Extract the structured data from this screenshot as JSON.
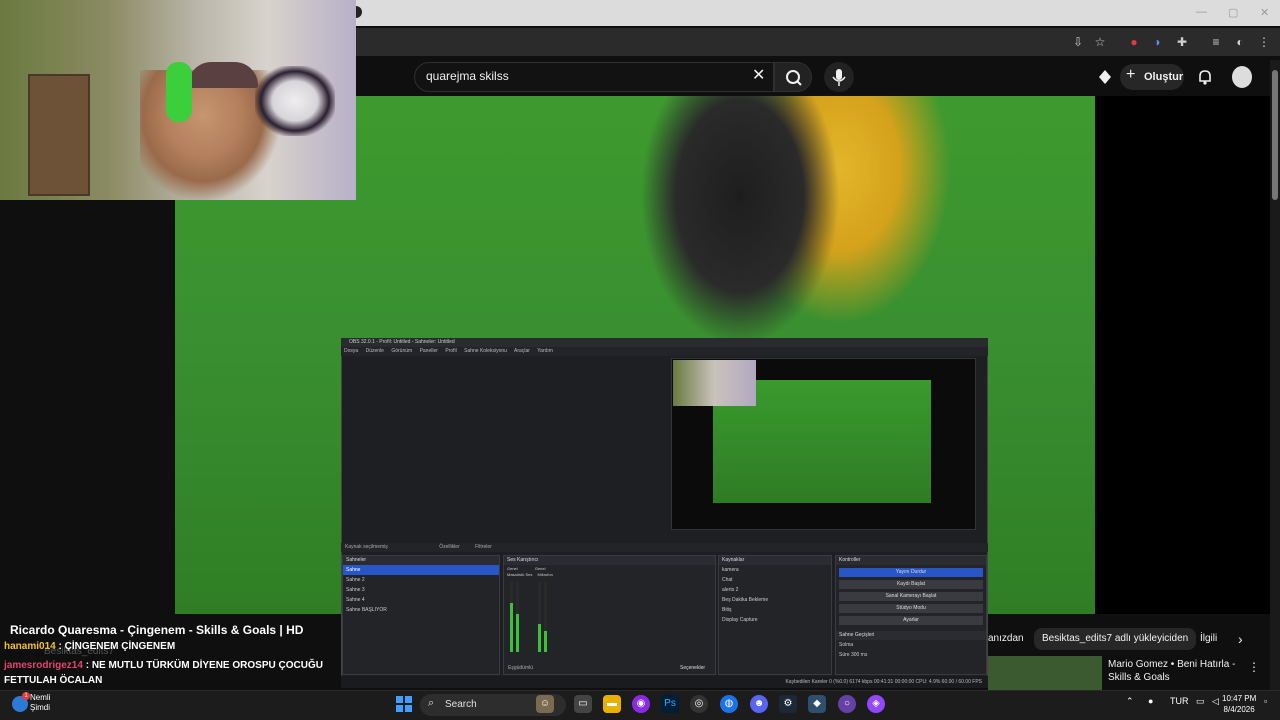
{
  "browser": {
    "window_controls": [
      "—",
      "▢",
      "✕"
    ],
    "icons": [
      "download-icon",
      "star-icon",
      "extension-shield-icon",
      "translate-icon",
      "puzzle-icon",
      "media-icon",
      "profile-icon",
      "more-icon"
    ]
  },
  "youtube": {
    "search": {
      "value": "quarejma skilss"
    },
    "create_label": "Oluştur",
    "video_title": "Ricardo Quaresma - Çingenem - Skills & Goals | HD",
    "chips": [
      "anızdan",
      "Besiktas_edits7 adlı yükleyiciden",
      "İlgili"
    ],
    "recommendation": {
      "title": "Mario Gomez • Beni Hatırla - Skills & Goals"
    }
  },
  "chat": {
    "background_text": "Besiktas_edits7",
    "messages": [
      {
        "user": "hanami014",
        "separator": " : ",
        "text": "ÇİNGENEM ÇİNGENEM"
      },
      {
        "user": "jamesrodrigez14",
        "separator": " : ",
        "text": "NE MUTLU TÜRKÜM DİYENE OROSPU ÇOCUĞU FETTULAH ÖCALAN"
      }
    ]
  },
  "obs": {
    "title": "OBS 32.0.1 - Profil: Untitled - Sahneler: Untitled",
    "menu": [
      "Dosya",
      "Düzenle",
      "Görünüm",
      "Paneller",
      "Profil",
      "Sahne Koleksiyonu",
      "Araçlar",
      "Yardım"
    ],
    "bar_label": "Kaynak seçilmemiş",
    "bar_options": [
      "Özellikler",
      "Filtreler"
    ],
    "scenes_title": "Sahneler",
    "scenes": [
      "Sahne",
      "Sahne 2",
      "Sahne 3",
      "Sahne 4",
      "Sahne BAŞLIYOR"
    ],
    "mixer_title": "Ses Karıştırıcı",
    "mixer_channels": [
      "Genel",
      "Genel"
    ],
    "mixer_labels": [
      "Masaüstü Ses",
      "Mikrofon"
    ],
    "sources_title": "Kaynaklar",
    "sources": [
      "kamera",
      "Chat",
      "alerts 2",
      "Beş Dakika Bekleme",
      "Bitiş",
      "Display Capture"
    ],
    "controls_title": "Kontroller",
    "controls": [
      "Yayını Durdur",
      "Kaydı Başlat",
      "Sanal Kamerayı Başlat",
      "Stüdyo Modu",
      "Ayarlar"
    ],
    "transitions_title": "Sahne Geçişleri",
    "transition_value": "Solma",
    "transition_duration": "Süre  300 ms",
    "status": "Kaybedilen Kareler 0 (%0.0)   6174 kbps   00:41:31   00:00:00   CPU: 4.9%   60.00 / 60.00 FPS",
    "seamless_label": "Seçenekler",
    "mixer_footer": "Eşgüdümlü"
  },
  "taskbar": {
    "notification": {
      "title": "Nemli",
      "subtitle": "Şimdi",
      "badge": "1"
    },
    "search_placeholder": "Search",
    "language": "TUR",
    "time": "10:47 PM",
    "date": "8/4/2026"
  },
  "colors": {
    "youtube_bg": "#0f0f0f",
    "obs_accent": "#2956c7",
    "pitch_green": "#3a9030",
    "chat_user1": "#f2c12e",
    "chat_user2": "#e0486d"
  }
}
